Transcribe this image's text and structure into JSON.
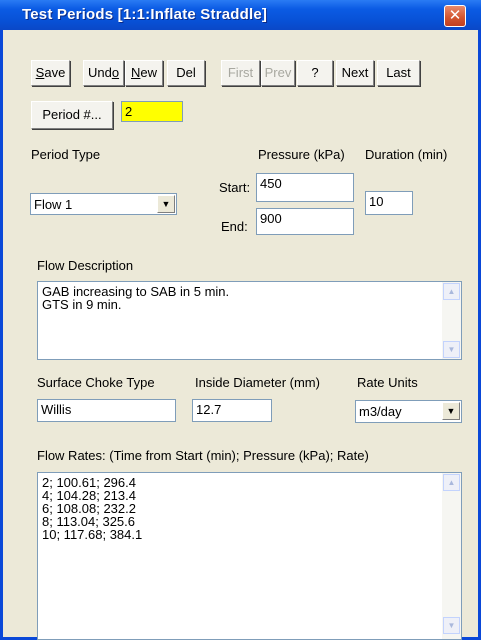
{
  "window": {
    "title": "Test Periods [1:1:Inflate Straddle]",
    "close_glyph": "✕"
  },
  "toolbar": {
    "save": {
      "first": "S",
      "rest": "ave"
    },
    "undo": {
      "first": "Und",
      "ul": "o"
    },
    "new": {
      "first": "N",
      "rest": "ew"
    },
    "del": "Del",
    "first": "First",
    "prev": "Prev",
    "help": "?",
    "next": "Next",
    "last": "Last"
  },
  "period": {
    "button_label": "Period #...",
    "value": "2"
  },
  "period_type": {
    "label": "Period Type",
    "value": "Flow 1"
  },
  "pressure": {
    "label": "Pressure (kPa)",
    "start_label": "Start:",
    "start_value": "450",
    "end_label": "End:",
    "end_value": "900"
  },
  "duration": {
    "label": "Duration (min)",
    "value": "10"
  },
  "flow_description": {
    "label": "Flow Description",
    "lines": [
      "GAB increasing to SAB in 5 min.",
      "GTS in 9 min."
    ]
  },
  "surface_choke": {
    "label": "Surface Choke Type",
    "value": "Willis"
  },
  "inside_diameter": {
    "label": "Inside Diameter (mm)",
    "value": "12.7"
  },
  "rate_units": {
    "label": "Rate Units",
    "value": "m3/day"
  },
  "flow_rates": {
    "label": "Flow Rates: (Time from Start (min); Pressure (kPa); Rate)",
    "lines": [
      "2; 100.61; 296.4",
      "4; 104.28; 213.4",
      "6; 108.08; 232.2",
      "8; 113.04; 325.6",
      "10; 117.68; 384.1"
    ]
  },
  "colors": {
    "title_bar": "#0b5be4",
    "window_face": "#ece9d8",
    "highlight": "#ffff00"
  }
}
